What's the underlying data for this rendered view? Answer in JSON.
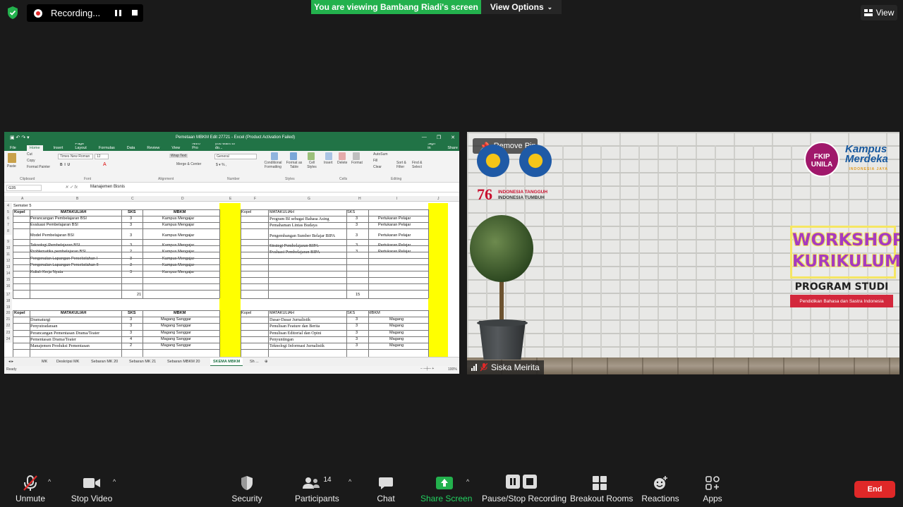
{
  "topbar": {
    "recording_label": "Recording...",
    "viewing_banner": "You are viewing Bambang Riadi's screen",
    "view_options": "View Options",
    "view_button": "View"
  },
  "excel": {
    "title": "Pemetaan MBKM Edit 27721 - Excel (Product Activation Failed)",
    "window_controls": [
      "—",
      "❐",
      "✕"
    ],
    "menu": [
      "File",
      "Home",
      "Insert",
      "Page Layout",
      "Formulas",
      "Data",
      "Review",
      "View",
      "Nitro Pro"
    ],
    "tell_me": "Tell me what you want to do...",
    "sign_in": "Sign in",
    "share": "Share",
    "font_name": "Times New Roman",
    "font_size": "12",
    "number_format": "General",
    "wrap_text": "Wrap Text",
    "merge_center": "Merge & Center",
    "paste": "Paste",
    "cut": "Cut",
    "copy": "Copy",
    "format_painter": "Format Painter",
    "autosum": "AutoSum",
    "fill": "Fill",
    "clear": "Clear",
    "ribbon_buttons": [
      "Conditional Formatting",
      "Format as Table",
      "Cell Styles",
      "Insert",
      "Delete",
      "Format",
      "Sort & Filter",
      "Find & Select"
    ],
    "ribbon_groups": [
      "Clipboard",
      "Font",
      "Alignment",
      "Number",
      "Styles",
      "Cells",
      "Editing"
    ],
    "name_box": "G35",
    "formula_value": "Manajemen Bisnis",
    "columns": [
      "A",
      "B",
      "C",
      "D",
      "E",
      "F",
      "G",
      "H",
      "I",
      "J"
    ],
    "rows": [
      "4",
      "5",
      "6",
      "7",
      "8",
      "9",
      "10",
      "11",
      "12",
      "13",
      "14",
      "15",
      "16",
      "17",
      "18",
      "19",
      "20",
      "21",
      "22",
      "23",
      "24"
    ],
    "semester": "Semster 5",
    "headers_top": {
      "kopel": "Kopel",
      "matakuliah": "MATAKULIAH",
      "sks": "SKS",
      "mbkm": "MBKM",
      "kopel2": "Kopel",
      "matakuliah2": "MATAKULIAH",
      "sks2": "SKS"
    },
    "left_top": [
      {
        "mk": "Perancangan Pembelajaran BSI",
        "sks": "3",
        "mbkm": "Kampus Mengajar"
      },
      {
        "mk": "Evaluasi Pembelajaran BSI",
        "sks": "3",
        "mbkm": "Kampus Mengajar"
      },
      {
        "mk": "Model Pembelajaran BSI",
        "sks": "3",
        "mbkm": "Kampus Mengajar"
      },
      {
        "mk": "Teknologi Pembelajaran BSI",
        "sks": "3",
        "mbkm": "Kampus Mengajar"
      },
      {
        "mk": "Problematika pembelajaran BSI",
        "sks": "2",
        "mbkm": "Kampus Mengajar"
      },
      {
        "mk": "Pengenalan Lapangan Persekolahan I",
        "sks": "3",
        "mbkm": "Kampus Mengajar"
      },
      {
        "mk": "Pengenalan Lapangan Persekolahan II",
        "sks": "3",
        "mbkm": "Kampus Mengajar"
      },
      {
        "mk": "Kuliah Kerja Nyata",
        "sks": "3",
        "mbkm": "Kampus Mengajar"
      }
    ],
    "right_top": [
      {
        "mk": "Program BI sebagai Bahasa Asing",
        "sks": "3",
        "mbkm": "Pertukaran Pelajar"
      },
      {
        "mk": "Pemahaman Lintas Budaya",
        "sks": "3",
        "mbkm": "Pertukaran Pelajar"
      },
      {
        "mk": "Pengembangan Sumber Belajar BIPA",
        "sks": "3",
        "mbkm": "Pertukaran Pelajar"
      },
      {
        "mk": "Strategi Pembelajaran BIPA",
        "sks": "3",
        "mbkm": "Pertukaran Pelajar"
      },
      {
        "mk": "Evaluasi Pembelajaran BIPA",
        "sks": "3",
        "mbkm": "Pertukaran Pelajar"
      }
    ],
    "total_left": "21",
    "total_right": "15",
    "headers_bottom": {
      "kopel": "Kopel",
      "matakuliah": "MATAKULIAH",
      "sks": "SKS",
      "mbkm": "MBKM",
      "kopel2": "Kopel",
      "matakuliah2": "MATAKULIAH",
      "sks2": "SKS",
      "mbkm2": "MBKM"
    },
    "left_bottom": [
      {
        "mk": "Dramaturgi",
        "sks": "3",
        "mbkm": "Magang Sanggar"
      },
      {
        "mk": "Penyutradaraan",
        "sks": "3",
        "mbkm": "Magang Sanggar"
      },
      {
        "mk": "Perancangan Pementasan Drama/Teater",
        "sks": "3",
        "mbkm": "Magang Sanggar"
      },
      {
        "mk": "Pementasan Drama/Teater",
        "sks": "4",
        "mbkm": "Magang Sanggar"
      },
      {
        "mk": "Manajemen Produksi Pementasan",
        "sks": "2",
        "mbkm": "Magang Sanggar"
      }
    ],
    "right_bottom": [
      {
        "mk": "Dasar-Dasar Jurnalistik",
        "sks": "3",
        "mbkm": "Magang"
      },
      {
        "mk": "Penulisan Feature dan Berita",
        "sks": "3",
        "mbkm": "Magang"
      },
      {
        "mk": "Penulisan Editorial dan Opini",
        "sks": "3",
        "mbkm": "Magang"
      },
      {
        "mk": "Penyuntingan",
        "sks": "3",
        "mbkm": "Magang"
      },
      {
        "mk": "Teknologi Informasi Jurnalistik",
        "sks": "3",
        "mbkm": "Magang"
      }
    ],
    "sheet_tabs": [
      "MK",
      "Deskripsi MK",
      "Sebaran MK 20",
      "Sebaran MK 21",
      "Sebaran MBKM 20",
      "SKEMA MBKM",
      "Sh ..."
    ],
    "active_tab": "SKEMA MBKM",
    "status_ready": "Ready",
    "zoom": "100%"
  },
  "video": {
    "remove_pin": "Remove Pin",
    "ri76_number": "76",
    "ri76_line1": "INDONESIA TANGGUH",
    "ri76_line2": "INDONESIA TUMBUH",
    "fkip_line1": "FKIP",
    "fkip_line2": "UNILA",
    "kampus_line1": "Kampus",
    "kampus_line2": "Merdeka",
    "kampus_sub": "INDONESIA JAYA",
    "workshop_line1": "WORKSHOP",
    "workshop_line2": "KURIKULUM",
    "program_studi": "PROGRAM STUDI",
    "prodi_name": "Pendidikan Bahasa dan Sastra Indonesia",
    "participant_name": "Siska Meirita"
  },
  "toolbar": {
    "unmute": "Unmute",
    "stop_video": "Stop Video",
    "security": "Security",
    "participants": "Participants",
    "participants_count": "14",
    "chat": "Chat",
    "share_screen": "Share Screen",
    "pause_stop_recording": "Pause/Stop Recording",
    "breakout_rooms": "Breakout Rooms",
    "reactions": "Reactions",
    "apps": "Apps",
    "end": "End"
  },
  "colors": {
    "banner_green": "#23b14d",
    "excel_green": "#217346",
    "end_red": "#e02828",
    "highlight_yellow": "#ffff00"
  }
}
